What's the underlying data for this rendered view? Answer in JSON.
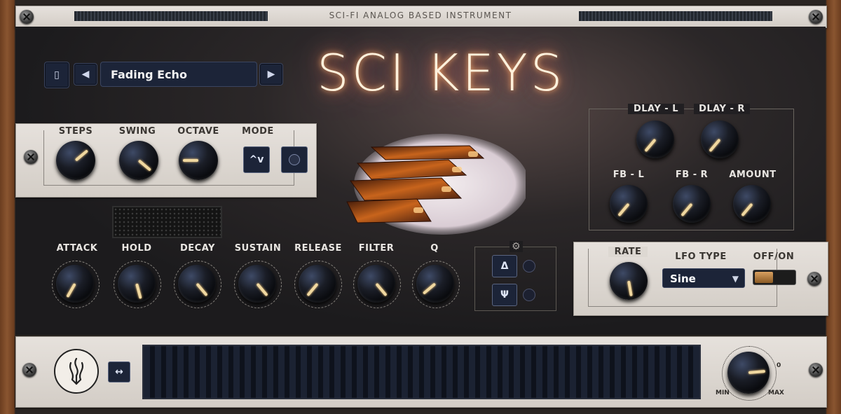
{
  "header": {
    "subtitle": "SCI-FI ANALOG BASED INSTRUMENT"
  },
  "title": "SCI KEYS",
  "preset": {
    "name": "Fading Echo",
    "prev_icon": "◀",
    "next_icon": "▶",
    "menu_icon": "▯"
  },
  "sequencer": {
    "labels": {
      "steps": "STEPS",
      "swing": "SWING",
      "octave": "OCTAVE",
      "mode": "MODE"
    },
    "mode_icon": "^v"
  },
  "delay": {
    "labels": {
      "dlay_l": "DLAY - L",
      "dlay_r": "DLAY - R",
      "fb_l": "FB - L",
      "fb_r": "FB - R",
      "amount": "AMOUNT"
    }
  },
  "envelope": {
    "labels": {
      "attack": "ATTACK",
      "hold": "HOLD",
      "decay": "DECAY",
      "sustain": "SUSTAIN",
      "release": "RELEASE",
      "filter": "FILTER",
      "q": "Q"
    }
  },
  "fx": {
    "btn1": "Δ",
    "btn2": "Ψ",
    "gear_icon": "⚙"
  },
  "lfo": {
    "rate_label": "RATE",
    "type_label": "LFO TYPE",
    "type_value": "Sine",
    "onoff_label": "OFF/ON"
  },
  "footer": {
    "expand_icon": "↔",
    "vol_min": "MIN",
    "vol_max": "MAX",
    "vol_zero": "0"
  },
  "colors": {
    "accent": "#f0d8a0",
    "panel": "#e2ddd7",
    "button": "#1c2438",
    "glow": "#ff8840"
  }
}
